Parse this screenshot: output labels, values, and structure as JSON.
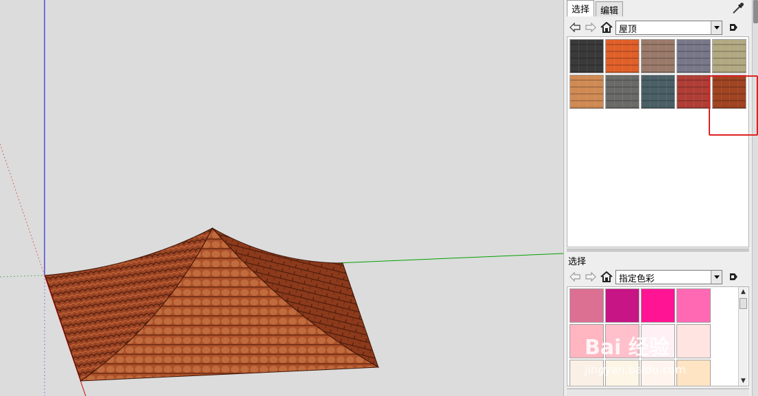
{
  "tabs": {
    "select": "选择",
    "edit": "编辑"
  },
  "materials_top": {
    "collection": "屋顶",
    "swatches": [
      {
        "name": "dark-slate-shingles",
        "color": "#3a3a3a"
      },
      {
        "name": "orange-tile",
        "color": "#e0602a"
      },
      {
        "name": "tan-shingles",
        "color": "#9a7a6a"
      },
      {
        "name": "gray-blue-shingles",
        "color": "#78788a"
      },
      {
        "name": "khaki-shingles",
        "color": "#b2a882"
      },
      {
        "name": "scalloped-tan-tile",
        "color": "#d08a54"
      },
      {
        "name": "gray-shingles",
        "color": "#6a6a68"
      },
      {
        "name": "teal-gray-shingles",
        "color": "#4a6066"
      },
      {
        "name": "red-metal",
        "color": "#b03e36"
      },
      {
        "name": "red-clay-tile",
        "color": "#a04422"
      }
    ]
  },
  "materials_bottom": {
    "section_title": "选择",
    "collection": "指定色彩",
    "swatches": [
      {
        "name": "pale-violet-red",
        "color": "#db7093"
      },
      {
        "name": "medium-violet-red",
        "color": "#c71585"
      },
      {
        "name": "deep-pink",
        "color": "#ff1493"
      },
      {
        "name": "hot-pink",
        "color": "#ff69b4"
      },
      {
        "name": "light-pink",
        "color": "#ffb6c1"
      },
      {
        "name": "pink",
        "color": "#ffc0cb"
      },
      {
        "name": "lavender-blush",
        "color": "#fff0f5"
      },
      {
        "name": "misty-rose",
        "color": "#ffe4e1"
      },
      {
        "name": "linen",
        "color": "#faf0e6"
      },
      {
        "name": "old-lace",
        "color": "#fdf5e6"
      },
      {
        "name": "seashell",
        "color": "#fff5ee"
      },
      {
        "name": "bisque",
        "color": "#ffe4c4"
      }
    ]
  },
  "watermark": {
    "logo": "Bai 经验",
    "url": "jingyan.baidu.com"
  },
  "accent_colors": {
    "highlight": "#e02020",
    "axis_green": "#00a000",
    "axis_blue": "#0000d0",
    "axis_red": "#d00000",
    "roof": "#8a3a1e"
  }
}
